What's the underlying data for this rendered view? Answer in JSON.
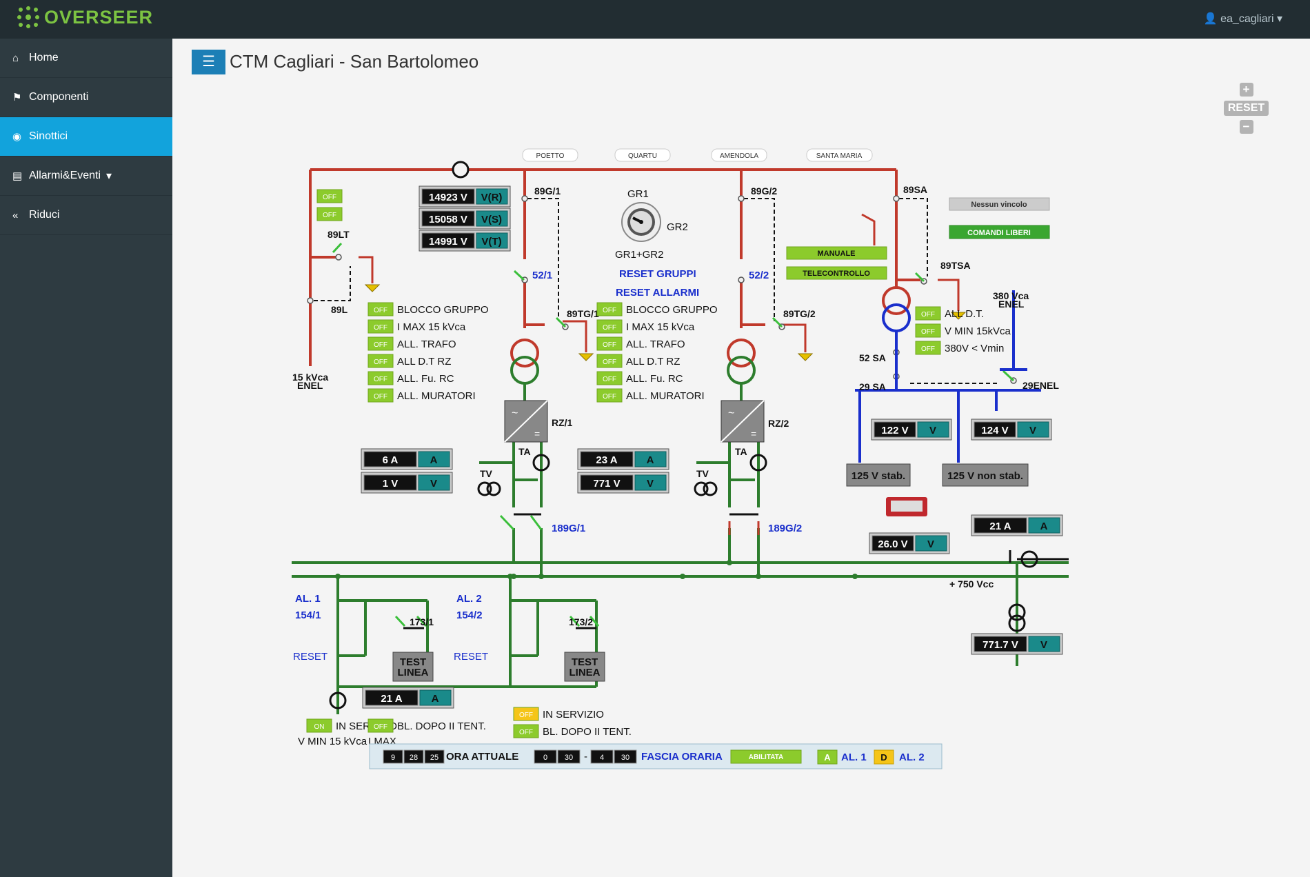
{
  "app": {
    "logo": "OVERSEER",
    "user": "ea_cagliari"
  },
  "sidebar": {
    "items": [
      {
        "label": "Home",
        "icon": "home-icon"
      },
      {
        "label": "Componenti",
        "icon": "tags-icon"
      },
      {
        "label": "Sinottici",
        "icon": "eye-icon",
        "active": true
      },
      {
        "label": "Allarmi&Eventi",
        "icon": "bar-chart-icon"
      },
      {
        "label": "Riduci",
        "icon": "double-chevron-left-icon"
      }
    ]
  },
  "page": {
    "title": "CTM Cagliari - San Bartolomeo"
  },
  "zoom": {
    "reset": "RESET"
  },
  "colors": {
    "red": "#c0392b",
    "green": "#2d7d2d",
    "blue": "#1a2fcc",
    "flag": "#8ccb2c",
    "amber": "#f5c518",
    "teal": "#1a8a8a"
  },
  "feeders": [
    "POETTO",
    "QUARTU",
    "AMENDOLA",
    "SANTA MARIA"
  ],
  "labels": {
    "v89g1": "89G/1",
    "v89g2": "89G/2",
    "v89sa": "89SA",
    "v89lt": "89LT",
    "v89l": "89L",
    "enel15a": "15 kVca",
    "enel15b": "ENEL",
    "v521": "52/1",
    "v522": "52/2",
    "v89tg1": "89TG/1",
    "v89tg2": "89TG/2",
    "v89tsa": "89TSA",
    "enel380a": "380 Vca",
    "enel380b": "ENEL",
    "v52sa": "52 SA",
    "v29sa": "29 SA",
    "v29enel": "29ENEL",
    "rz1": "RZ/1",
    "rz2": "RZ/2",
    "ta1": "TA",
    "ta2": "TA",
    "tv1": "TV",
    "tv2": "TV",
    "v189g1": "189G/1",
    "v189g2": "189G/2",
    "vcc": "+ 750 Vcc",
    "al1": "AL. 1",
    "al2": "AL. 2",
    "v1541": "154/1",
    "v1542": "154/2",
    "v1731": "173/1",
    "v1732": "173/2",
    "reset1": "RESET",
    "reset2": "RESET",
    "test1a": "TEST",
    "test1b": "LINEA",
    "test2a": "TEST",
    "test2b": "LINEA",
    "gr1": "GR1",
    "gr2": "GR2",
    "gr12": "GR1+GR2",
    "reset_gruppi": "RESET GRUPPI",
    "reset_allarmi": "RESET ALLARMI",
    "nessun": "Nessun vincolo",
    "comandi": "COMANDI LIBERI",
    "manuale": "MANUALE",
    "telecontrollo": "TELECONTROLLO",
    "stab": "125 V stab.",
    "nonstab": "125 V non stab."
  },
  "flags": {
    "off": "OFF",
    "on": "ON",
    "top_left": [
      "V MIN 15 kVca",
      "I MAX"
    ],
    "group": [
      "BLOCCO GRUPPO",
      "I MAX 15 kVca",
      "ALL. TRAFO",
      "ALL D.T RZ",
      "ALL. Fu. RC",
      "ALL. MURATORI"
    ],
    "group2": [
      "BLOCCO GRUPPO",
      "I MAX 15 kVca",
      "ALL. TRAFO",
      "ALL D.T RZ",
      "ALL. Fu. RC",
      "ALL. MURATORI"
    ],
    "sa": [
      "ALL D.T.",
      "V MIN 15kVca",
      "380V < Vmin"
    ],
    "line1": [
      "IN SERVIZIO",
      "BL. DOPO II TENT."
    ],
    "line2": [
      "IN SERVIZIO",
      "BL. DOPO II TENT."
    ]
  },
  "meters": {
    "vr": {
      "value": "14923 V",
      "unit": "V(R)"
    },
    "vs": {
      "value": "15058 V",
      "unit": "V(S)"
    },
    "vt": {
      "value": "14991 V",
      "unit": "V(T)"
    },
    "g1a": {
      "value": "6 A",
      "unit": "A"
    },
    "g1v": {
      "value": "1 V",
      "unit": "V"
    },
    "g2a": {
      "value": "23 A",
      "unit": "A"
    },
    "g2v": {
      "value": "771 V",
      "unit": "V"
    },
    "sa122": {
      "value": "122 V",
      "unit": "V"
    },
    "sa124": {
      "value": "124 V",
      "unit": "V"
    },
    "batt": {
      "value": "26.0 V",
      "unit": "V"
    },
    "bus_a": {
      "value": "21 A",
      "unit": "A"
    },
    "bus_v": {
      "value": "771.7 V",
      "unit": "V"
    },
    "line_a": {
      "value": "21 A",
      "unit": "A"
    }
  },
  "timebar": {
    "ora_label": "ORA ATTUALE",
    "ora": [
      "9",
      "28",
      "25"
    ],
    "start": [
      "0",
      "30"
    ],
    "sep": "-",
    "end": [
      "4",
      "30"
    ],
    "fascia_label": "FASCIA ORARIA",
    "abilitata": "ABILITATA",
    "a": "A",
    "al1": "AL. 1",
    "d": "D",
    "al2": "AL. 2"
  }
}
